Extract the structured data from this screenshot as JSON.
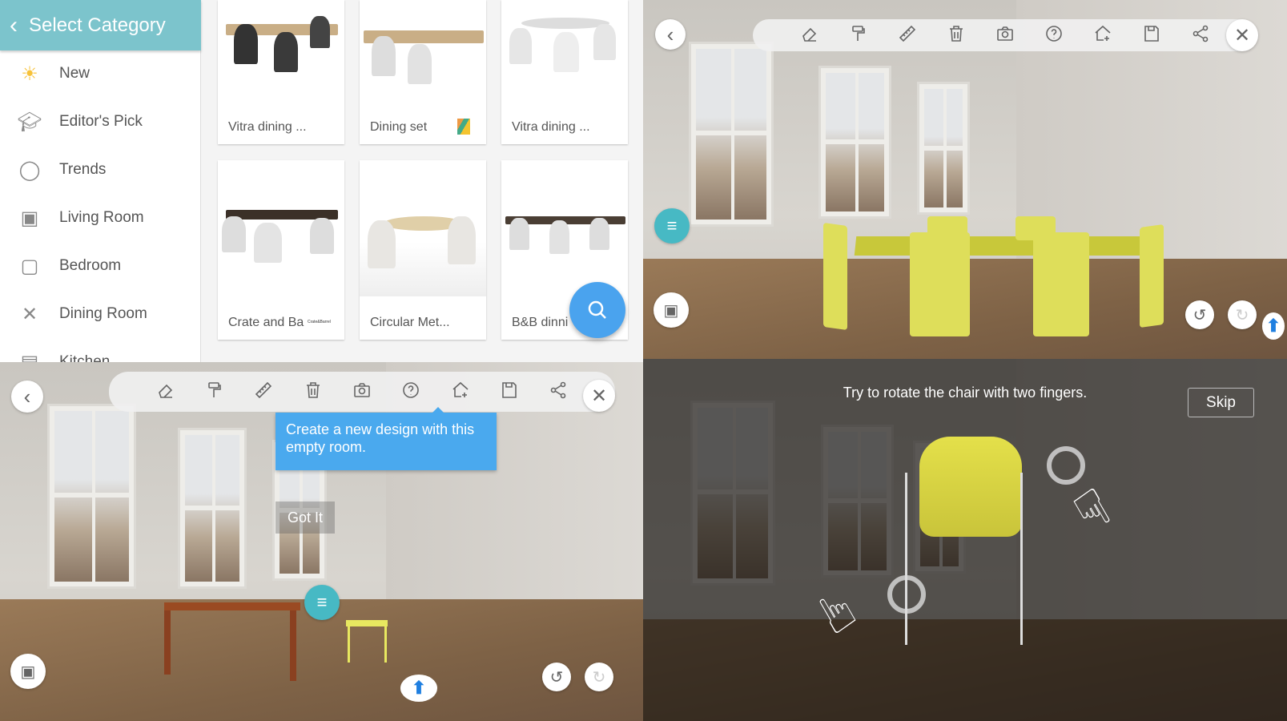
{
  "catalog": {
    "header_title": "Select Category",
    "categories": [
      {
        "label": "New",
        "icon": "sun-icon"
      },
      {
        "label": "Editor's Pick",
        "icon": "graduation-cap-icon"
      },
      {
        "label": "Trends",
        "icon": "mustache-icon"
      },
      {
        "label": "Living Room",
        "icon": "armchair-icon"
      },
      {
        "label": "Bedroom",
        "icon": "pillow-icon"
      },
      {
        "label": "Dining Room",
        "icon": "fork-knife-icon"
      },
      {
        "label": "Kitchen",
        "icon": "kitchen-icon"
      }
    ],
    "products": [
      {
        "label": "Vitra dining ..."
      },
      {
        "label": "Dining set"
      },
      {
        "label": "Vitra dining ..."
      },
      {
        "label": "Crate and Ba"
      },
      {
        "label": "Circular Met..."
      },
      {
        "label": "B&B dinni"
      }
    ],
    "brand_logo_text": "Crate&Barrel",
    "accent_color": "#7cc4cc",
    "fab_color": "#4aa3ee"
  },
  "toolbar_icons": [
    "eraser-icon",
    "paint-roller-icon",
    "ruler-icon",
    "trash-icon",
    "camera-icon",
    "help-icon",
    "new-room-icon",
    "save-icon",
    "share-icon"
  ],
  "tutorial_tip": {
    "text": "Create a new design with this empty room.",
    "button": "Got It"
  },
  "gesture_hint": {
    "text": "Try to rotate the chair with two fingers.",
    "skip": "Skip"
  }
}
